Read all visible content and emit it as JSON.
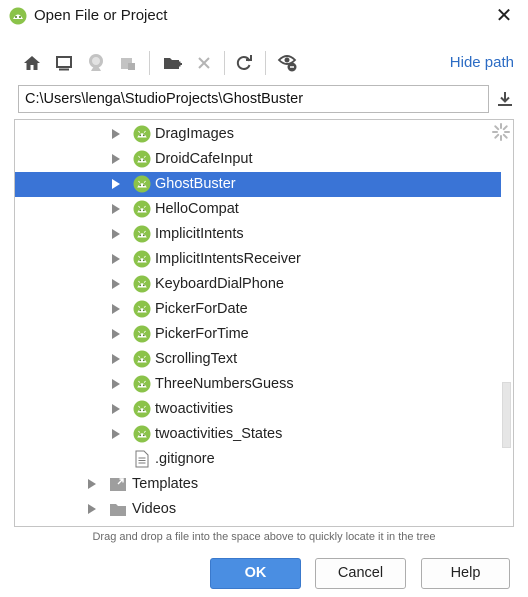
{
  "window": {
    "title": "Open File or Project",
    "close_glyph": "✕"
  },
  "toolbar": {
    "hide_path_label": "Hide path",
    "icons": [
      "home-icon",
      "desktop-icon",
      "project-icon",
      "module-icon",
      "new-folder-icon",
      "delete-icon",
      "refresh-icon",
      "show-hidden-icon"
    ]
  },
  "path": {
    "value": "C:\\Users\\lenga\\StudioProjects\\GhostBuster"
  },
  "tree": {
    "items": [
      {
        "label": "DragImages",
        "kind": "android",
        "selected": false
      },
      {
        "label": "DroidCafeInput",
        "kind": "android",
        "selected": false
      },
      {
        "label": "GhostBuster",
        "kind": "android",
        "selected": true
      },
      {
        "label": "HelloCompat",
        "kind": "android",
        "selected": false
      },
      {
        "label": "ImplicitIntents",
        "kind": "android",
        "selected": false
      },
      {
        "label": "ImplicitIntentsReceiver",
        "kind": "android",
        "selected": false
      },
      {
        "label": "KeyboardDialPhone",
        "kind": "android",
        "selected": false
      },
      {
        "label": "PickerForDate",
        "kind": "android",
        "selected": false
      },
      {
        "label": "PickerForTime",
        "kind": "android",
        "selected": false
      },
      {
        "label": "ScrollingText",
        "kind": "android",
        "selected": false
      },
      {
        "label": "ThreeNumbersGuess",
        "kind": "android",
        "selected": false
      },
      {
        "label": "twoactivities",
        "kind": "android",
        "selected": false
      },
      {
        "label": "twoactivities_States",
        "kind": "android",
        "selected": false
      },
      {
        "label": ".gitignore",
        "kind": "file",
        "selected": false
      },
      {
        "label": "Templates",
        "kind": "folder-link",
        "selected": false
      },
      {
        "label": "Videos",
        "kind": "folder",
        "selected": false
      }
    ]
  },
  "hint": "Drag and drop a file into the space above to quickly locate it in the tree",
  "buttons": {
    "ok": "OK",
    "cancel": "Cancel",
    "help": "Help"
  },
  "colors": {
    "selection": "#3a74d6",
    "android_green": "#8bc34a",
    "link": "#2c6cc4",
    "ok_button": "#4a8ee2"
  }
}
